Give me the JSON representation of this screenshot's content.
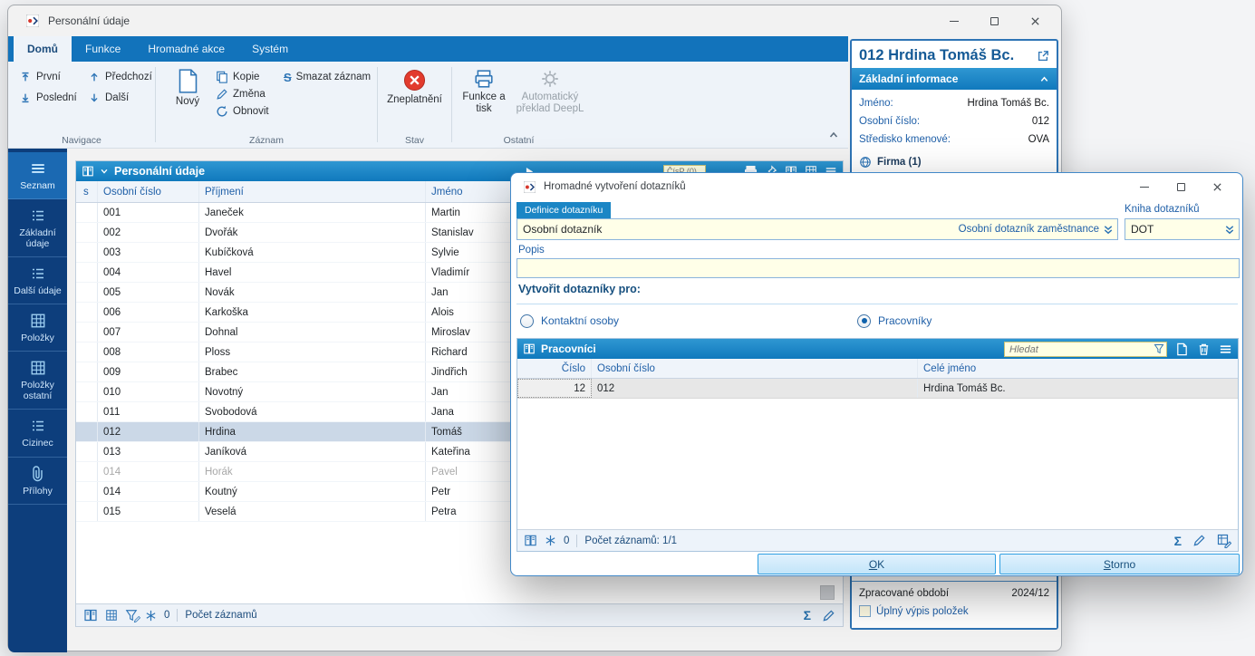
{
  "app": {
    "window_title": "Personální údaje"
  },
  "ribbon": {
    "tabs": [
      "Domů",
      "Funkce",
      "Hromadné akce",
      "Systém"
    ],
    "buttons": {
      "first": "První",
      "previous": "Předchozí",
      "last": "Poslední",
      "next": "Další",
      "new": "Nový",
      "copy": "Kopie",
      "change": "Změna",
      "refresh": "Obnovit",
      "delete_record": "Smazat záznam",
      "delete_glyph": "S",
      "invalidate": "Zneplatnění",
      "functions_print": "Funkce a tisk",
      "deepl": "Automatický překlad DeepL"
    },
    "groups": {
      "navigation": "Navigace",
      "record": "Záznam",
      "state": "Stav",
      "other": "Ostatní"
    }
  },
  "sidebar": {
    "items": [
      {
        "label": "Seznam",
        "state": "selected"
      },
      {
        "label": "Základní údaje"
      },
      {
        "label": "Další údaje"
      },
      {
        "label": "Položky"
      },
      {
        "label": "Položky ostatní"
      },
      {
        "label": "Cizinec"
      },
      {
        "label": "Přílohy"
      }
    ]
  },
  "grid": {
    "title": "Personální údaje",
    "search_placeholder": "ČísP (0)",
    "columns": [
      "s",
      "Osobní číslo",
      "Příjmení",
      "Jméno"
    ],
    "rows": [
      {
        "cislo": "001",
        "prijmeni": "Janeček",
        "jmeno": "Martin"
      },
      {
        "cislo": "002",
        "prijmeni": "Dvořák",
        "jmeno": "Stanislav"
      },
      {
        "cislo": "003",
        "prijmeni": "Kubíčková",
        "jmeno": "Sylvie"
      },
      {
        "cislo": "004",
        "prijmeni": "Havel",
        "jmeno": "Vladimír"
      },
      {
        "cislo": "005",
        "prijmeni": "Novák",
        "jmeno": "Jan"
      },
      {
        "cislo": "006",
        "prijmeni": "Karkoška",
        "jmeno": "Alois"
      },
      {
        "cislo": "007",
        "prijmeni": "Dohnal",
        "jmeno": "Miroslav"
      },
      {
        "cislo": "008",
        "prijmeni": "Ploss",
        "jmeno": "Richard"
      },
      {
        "cislo": "009",
        "prijmeni": "Brabec",
        "jmeno": "Jindřich"
      },
      {
        "cislo": "010",
        "prijmeni": "Novotný",
        "jmeno": "Jan"
      },
      {
        "cislo": "011",
        "prijmeni": "Svobodová",
        "jmeno": "Jana"
      },
      {
        "cislo": "012",
        "prijmeni": "Hrdina",
        "jmeno": "Tomáš",
        "state": "selected"
      },
      {
        "cislo": "013",
        "prijmeni": "Janíková",
        "jmeno": "Kateřina"
      },
      {
        "cislo": "014",
        "prijmeni": "Horák",
        "jmeno": "Pavel",
        "state": "inactive"
      },
      {
        "cislo": "014",
        "prijmeni": "Koutný",
        "jmeno": "Petr"
      },
      {
        "cislo": "015",
        "prijmeni": "Veselá",
        "jmeno": "Petra"
      }
    ],
    "status": {
      "frozen": "0",
      "records": "Počet záznamů"
    }
  },
  "detail": {
    "title": "012 Hrdina Tomáš Bc.",
    "section": "Základní informace",
    "fields": [
      {
        "label": "Jméno:",
        "value": "Hrdina Tomáš Bc."
      },
      {
        "label": "Osobní číslo:",
        "value": "012"
      },
      {
        "label": "Středisko kmenové:",
        "value": "OVA"
      }
    ],
    "company_link": "Firma (1)",
    "period_label": "Zpracované období",
    "period_value": "2024/12",
    "full_listing_label": "Úplný výpis položek"
  },
  "dialog": {
    "title": "Hromadné vytvoření dotazníků",
    "definition_tab": "Definice dotazníku",
    "definition_value": "Osobní dotazník",
    "definition_type": "Osobní dotazník zaměstnance",
    "book_label": "Kniha dotazníků",
    "book_value": "DOT",
    "popis_label": "Popis",
    "popis_value": "",
    "create_for_heading": "Vytvořit dotazníky pro:",
    "radio_contacts": "Kontaktní osoby",
    "radio_workers": "Pracovníky",
    "workers_panel": {
      "title": "Pracovníci",
      "search_placeholder": "Hledat",
      "columns": [
        "Číslo",
        "Osobní číslo",
        "Celé jméno"
      ],
      "rows": [
        {
          "cislo": "12",
          "osobni_cislo": "012",
          "cele_jmeno": "Hrdina Tomáš Bc.",
          "state": "selected"
        }
      ],
      "status": {
        "frozen": "0",
        "records": "Počet záznamů: 1/1"
      }
    },
    "buttons": {
      "ok_accel": "O",
      "ok_rest": "K",
      "storno_accel": "S",
      "storno_rest": "torno"
    }
  },
  "colors": {
    "accent_blue": "#1273bb",
    "header_blue": "#1079bd",
    "sidebar_navy": "#0d3e7c",
    "field_yellow": "#ffffe8",
    "invalid_red": "#e23b2e"
  }
}
